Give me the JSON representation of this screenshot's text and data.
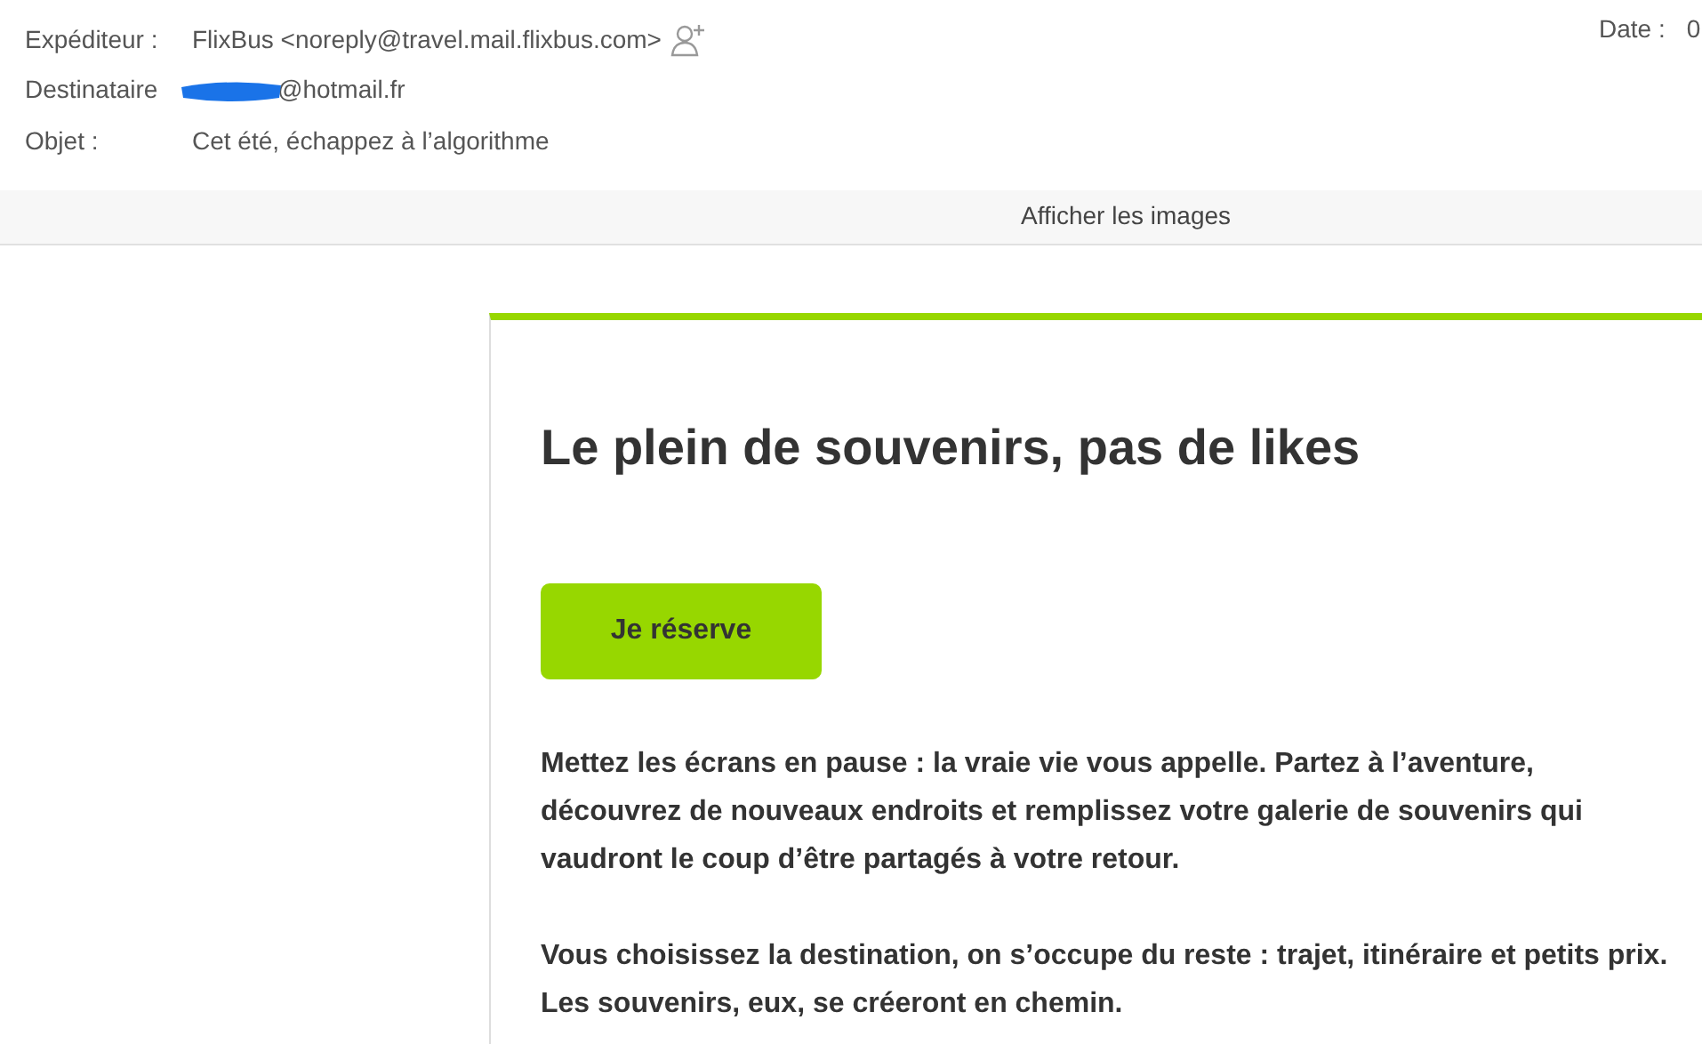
{
  "header": {
    "fields": [
      {
        "label": "Expéditeur :",
        "value": "FlixBus <noreply@travel.mail.flixbus.com>",
        "kind": "sender"
      },
      {
        "label": "Destinataire",
        "value": "@hotmail.fr",
        "kind": "redacted"
      },
      {
        "label": "Objet :",
        "value": "Cet été, échappez à l’algorithme",
        "kind": "plain"
      }
    ],
    "date_label": "Date :",
    "date_value": "0"
  },
  "images_bar": {
    "label": "Afficher les images"
  },
  "email": {
    "title": "Le plein de souvenirs, pas de likes",
    "button": "Je réserve",
    "paragraphs": [
      "Mettez les écrans en pause : la vraie vie vous appelle. Partez à l’aventure, découvrez de nouveaux endroits et remplissez votre galerie de souvenirs qui vaudront le coup d’être partagés à votre retour.",
      "Vous choisissez la destination, on s’occupe du reste : trajet, itinéraire et petits prix. Les souvenirs, eux, se créeront en chemin."
    ]
  }
}
